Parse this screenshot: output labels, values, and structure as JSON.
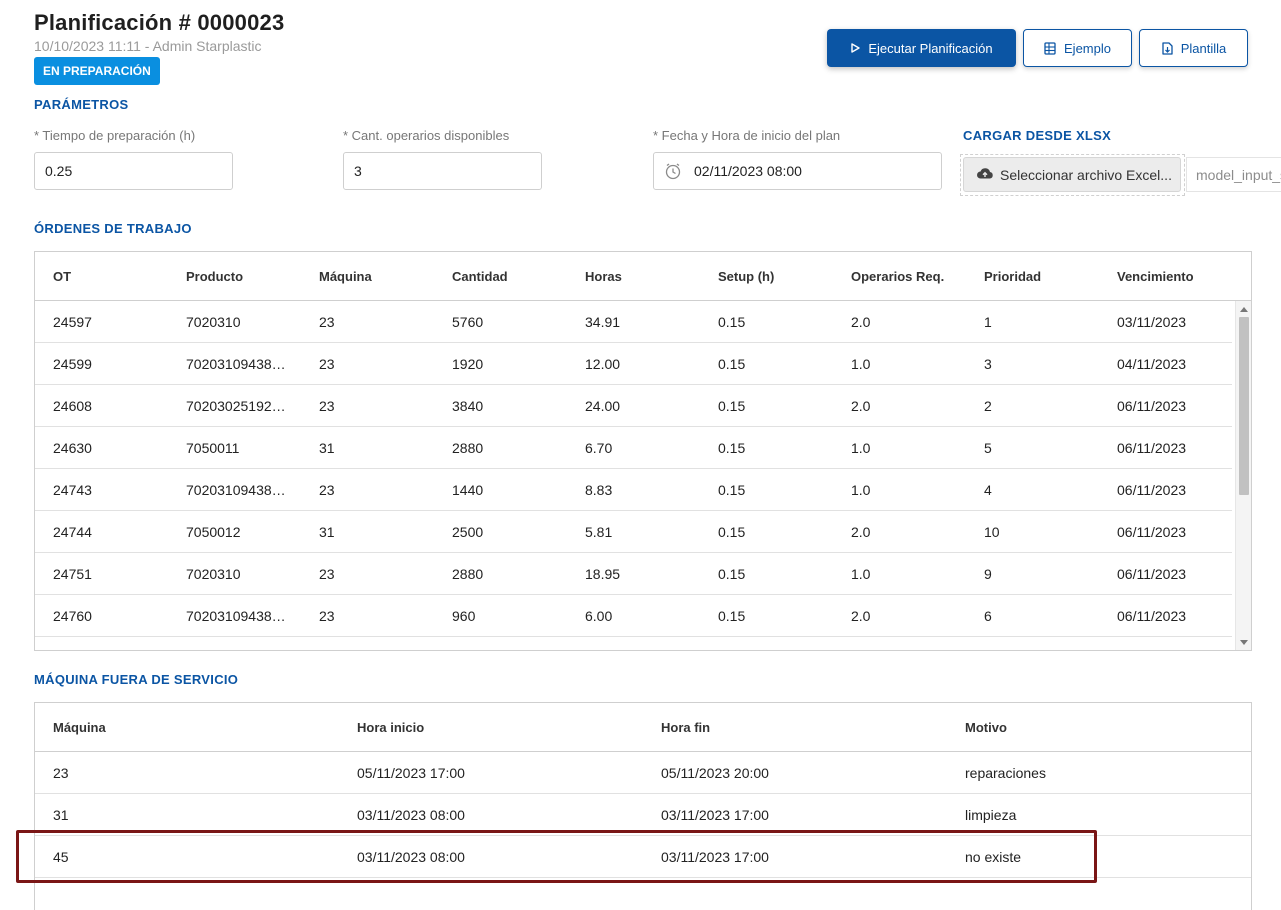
{
  "header": {
    "title": "Planificación # 0000023",
    "subtitle": "10/10/2023 11:11 - Admin Starplastic",
    "status": "EN PREPARACIÓN"
  },
  "toolbar": {
    "run_label": "Ejecutar Planificación",
    "example_label": "Ejemplo",
    "template_label": "Plantilla"
  },
  "params": {
    "section_title": "PARÁMETROS",
    "setup_label": "* Tiempo de preparación (h)",
    "setup_value": "0.25",
    "operators_label": "* Cant. operarios disponibles",
    "operators_value": "3",
    "start_label": "* Fecha y Hora de inicio del plan",
    "start_value": "02/11/2023 08:00",
    "upload_title": "CARGAR DESDE XLSX",
    "upload_button": "Seleccionar archivo Excel...",
    "upload_filename": "model_input_s"
  },
  "orders": {
    "section_title": "ÓRDENES DE TRABAJO",
    "columns": [
      "OT",
      "Producto",
      "Máquina",
      "Cantidad",
      "Horas",
      "Setup (h)",
      "Operarios Req.",
      "Prioridad",
      "Vencimiento"
    ],
    "rows": [
      [
        "24597",
        "7020310",
        "23",
        "5760",
        "34.91",
        "0.15",
        "2.0",
        "1",
        "03/11/2023"
      ],
      [
        "24599",
        "70203109438…",
        "23",
        "1920",
        "12.00",
        "0.15",
        "1.0",
        "3",
        "04/11/2023"
      ],
      [
        "24608",
        "70203025192…",
        "23",
        "3840",
        "24.00",
        "0.15",
        "2.0",
        "2",
        "06/11/2023"
      ],
      [
        "24630",
        "7050011",
        "31",
        "2880",
        "6.70",
        "0.15",
        "1.0",
        "5",
        "06/11/2023"
      ],
      [
        "24743",
        "70203109438…",
        "23",
        "1440",
        "8.83",
        "0.15",
        "1.0",
        "4",
        "06/11/2023"
      ],
      [
        "24744",
        "7050012",
        "31",
        "2500",
        "5.81",
        "0.15",
        "2.0",
        "10",
        "06/11/2023"
      ],
      [
        "24751",
        "7020310",
        "23",
        "2880",
        "18.95",
        "0.15",
        "1.0",
        "9",
        "06/11/2023"
      ],
      [
        "24760",
        "70203109438…",
        "23",
        "960",
        "6.00",
        "0.15",
        "2.0",
        "6",
        "06/11/2023"
      ]
    ]
  },
  "out_of_service": {
    "section_title": "MÁQUINA FUERA DE SERVICIO",
    "columns": [
      "Máquina",
      "Hora inicio",
      "Hora fin",
      "Motivo"
    ],
    "rows": [
      [
        "23",
        "05/11/2023 17:00",
        "05/11/2023 20:00",
        "reparaciones"
      ],
      [
        "31",
        "03/11/2023 08:00",
        "03/11/2023 17:00",
        "limpieza"
      ],
      [
        "45",
        "03/11/2023 08:00",
        "03/11/2023 17:00",
        "no existe"
      ]
    ]
  },
  "colors": {
    "primary": "#0b55a4",
    "badge": "#0a8fe0",
    "highlight": "#7a1616"
  }
}
